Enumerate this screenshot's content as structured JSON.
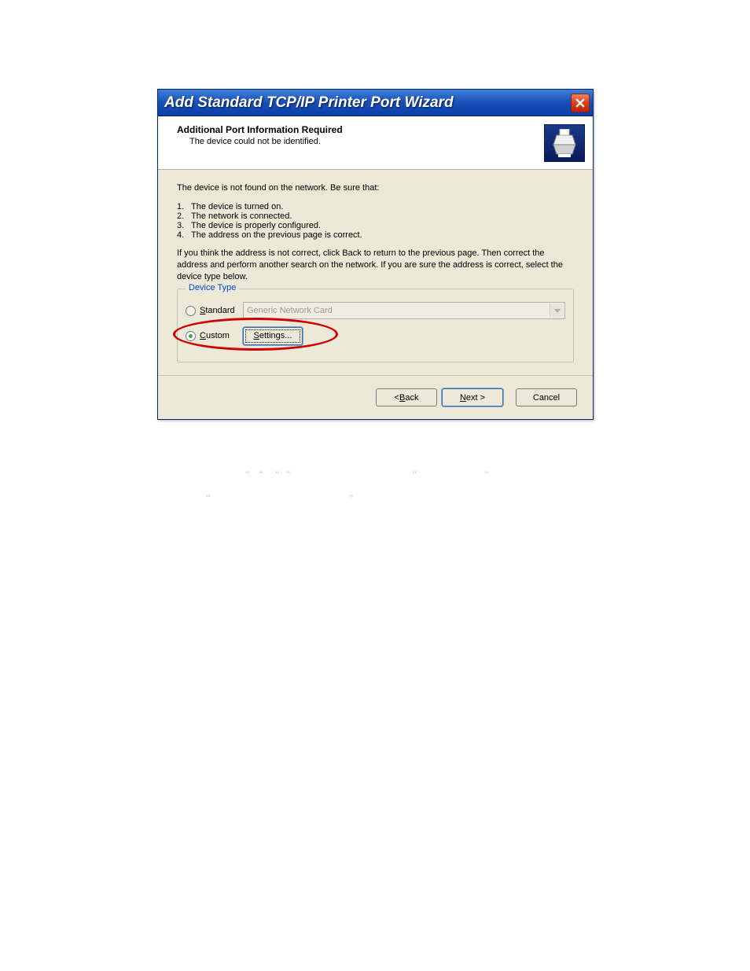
{
  "dialog": {
    "title": "Add Standard TCP/IP Printer Port Wizard",
    "header": {
      "title": "Additional Port Information Required",
      "subtitle": "The device could not be identified."
    },
    "body": {
      "intro": "The device is not found on the network.  Be sure that:",
      "list": [
        "The device is turned on.",
        "The network is connected.",
        "The device is properly configured.",
        "The address on the previous page is correct."
      ],
      "paragraph": "If you think the address is not correct, click Back to return to the previous page.  Then correct the address and perform another search on the network.  If you are sure the address is correct, select the device type below."
    },
    "group": {
      "legend": "Device Type",
      "standard_label": "Standard",
      "standard_combo": "Generic Network Card",
      "custom_label": "Custom",
      "settings_btn": "Settings..."
    },
    "footer": {
      "back": "< Back",
      "next": "Next >",
      "cancel": "Cancel"
    }
  }
}
